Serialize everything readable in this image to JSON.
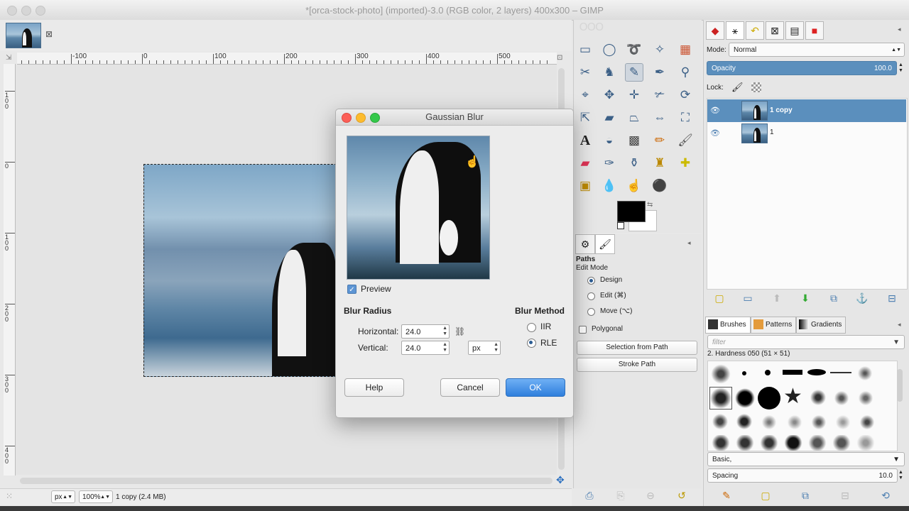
{
  "window": {
    "title": "*[orca-stock-photo] (imported)-3.0 (RGB color, 2 layers) 400x300 – GIMP"
  },
  "ruler": {
    "h_labels": [
      "-100",
      "0",
      "100",
      "200",
      "300",
      "400",
      "500"
    ],
    "v_labels": [
      "1|0|0",
      "0",
      "1|0|0",
      "2|0|0",
      "3|0|0",
      "4|0|0"
    ]
  },
  "statusbar": {
    "unit": "px",
    "zoom": "100%",
    "layer_info": "1 copy (2.4 MB)"
  },
  "dialog": {
    "title": "Gaussian Blur",
    "preview_label": "Preview",
    "blur_radius_label": "Blur Radius",
    "horizontal_label": "Horizontal:",
    "horizontal_value": "24.0",
    "vertical_label": "Vertical:",
    "vertical_value": "24.0",
    "unit": "px",
    "blur_method_label": "Blur Method",
    "method_iir": "IIR",
    "method_rle": "RLE",
    "help": "Help",
    "cancel": "Cancel",
    "ok": "OK"
  },
  "paths_dock": {
    "title": "Paths",
    "edit_mode": "Edit Mode",
    "design": "Design",
    "edit": "Edit (⌘)",
    "move": "Move (⌥)",
    "polygonal": "Polygonal",
    "selection_from_path": "Selection from Path",
    "stroke_path": "Stroke Path"
  },
  "layers": {
    "mode_label": "Mode:",
    "mode_value": "Normal",
    "opacity_label": "Opacity",
    "opacity_value": "100.0",
    "lock_label": "Lock:",
    "items": [
      {
        "name": "1 copy"
      },
      {
        "name": "1"
      }
    ]
  },
  "brushes": {
    "tabs": [
      "Brushes",
      "Patterns",
      "Gradients"
    ],
    "filter_placeholder": "filter",
    "selected": "2. Hardness 050 (51 × 51)",
    "preset": "Basic,",
    "spacing_label": "Spacing",
    "spacing_value": "10.0"
  },
  "colors": {
    "accent": "#5b8fbd",
    "fg": "#000000",
    "bg": "#ffffff",
    "ok_button": "#2f7fdc"
  }
}
